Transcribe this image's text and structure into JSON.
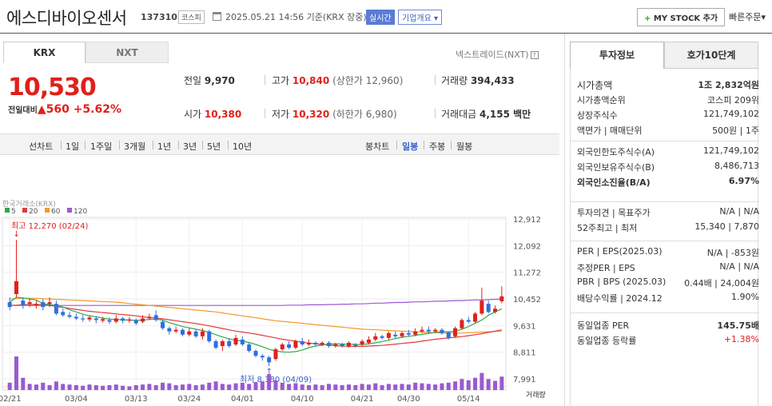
{
  "header": {
    "title": "에스디바이오센서",
    "code": "137310",
    "market": "코스피",
    "date": "2025.05.21 14:56 기준(KRX 장중)",
    "realtime": "실시간",
    "overview": "기업개요",
    "mystock": "MY STOCK 추가",
    "quick_order": "빠른주문"
  },
  "tabs": {
    "krx": "KRX",
    "nxt": "NXT",
    "nxt_link": "넥스트레이드(NXT)"
  },
  "quote": {
    "price": "10,530",
    "change_label": "전일대비",
    "change": "560",
    "change_pct": "+5.62%",
    "prev_label": "전일",
    "prev": "9,970",
    "high_label": "고가",
    "high": "10,840",
    "upper_label": "(상한가",
    "upper": "12,960)",
    "volume_label": "거래량",
    "volume": "394,433",
    "open_label": "시가",
    "open": "10,380",
    "low_label": "저가",
    "low": "10,320",
    "lower_label": "(하한가",
    "lower": "6,980)",
    "amount_label": "거래대금",
    "amount": "4,155 백만"
  },
  "periods": {
    "line_label": "선차트",
    "items": [
      "1일",
      "1주일",
      "3개월",
      "1년",
      "3년",
      "5년",
      "10년"
    ],
    "candle_label": "봉차트",
    "candles": [
      "일봉",
      "주봉",
      "월봉"
    ]
  },
  "chart_data": {
    "type": "candlestick",
    "source_label": "한국거래소(KRX)",
    "ma_legend": [
      {
        "name": "5",
        "color": "#2ea84f"
      },
      {
        "name": "20",
        "color": "#e03a3a"
      },
      {
        "name": "60",
        "color": "#f39a2b"
      },
      {
        "name": "120",
        "color": "#9b59d0"
      }
    ],
    "y_ticks": [
      "12,912",
      "12,092",
      "11,272",
      "10,452",
      "9,631",
      "8,811",
      "7,991"
    ],
    "ylim": [
      7991,
      12912
    ],
    "x_ticks": [
      "02/21",
      "03/04",
      "03/13",
      "03/24",
      "04/01",
      "04/10",
      "04/21",
      "04/30",
      "05/14"
    ],
    "max_label": "최고 12,270 (02/24)",
    "min_label": "최저 8,380 (04/09)",
    "volume_label": "거래량",
    "candles": [
      {
        "o": 10350,
        "c": 10200,
        "h": 10500,
        "l": 10100
      },
      {
        "o": 10600,
        "c": 11000,
        "h": 12270,
        "l": 10500
      },
      {
        "o": 10400,
        "c": 10250,
        "h": 10500,
        "l": 10150
      },
      {
        "o": 10300,
        "c": 10350,
        "h": 10450,
        "l": 10200
      },
      {
        "o": 10250,
        "c": 10300,
        "h": 10400,
        "l": 10150
      },
      {
        "o": 10350,
        "c": 10200,
        "h": 10450,
        "l": 10100
      },
      {
        "o": 10300,
        "c": 10350,
        "h": 10500,
        "l": 10200
      },
      {
        "o": 10300,
        "c": 10000,
        "h": 10400,
        "l": 9950
      },
      {
        "o": 10050,
        "c": 9950,
        "h": 10150,
        "l": 9900
      },
      {
        "o": 9950,
        "c": 9900,
        "h": 10050,
        "l": 9850
      },
      {
        "o": 9900,
        "c": 9850,
        "h": 10000,
        "l": 9800
      },
      {
        "o": 9850,
        "c": 9820,
        "h": 9950,
        "l": 9750
      },
      {
        "o": 9820,
        "c": 9880,
        "h": 9950,
        "l": 9750
      },
      {
        "o": 9850,
        "c": 9800,
        "h": 9900,
        "l": 9700
      },
      {
        "o": 9780,
        "c": 9830,
        "h": 9900,
        "l": 9720
      },
      {
        "o": 9800,
        "c": 9750,
        "h": 9880,
        "l": 9680
      },
      {
        "o": 9750,
        "c": 9850,
        "h": 9950,
        "l": 9700
      },
      {
        "o": 9850,
        "c": 9780,
        "h": 9900,
        "l": 9700
      },
      {
        "o": 9780,
        "c": 9820,
        "h": 9900,
        "l": 9720
      },
      {
        "o": 9800,
        "c": 9700,
        "h": 9850,
        "l": 9650
      },
      {
        "o": 9750,
        "c": 9850,
        "h": 9950,
        "l": 9700
      },
      {
        "o": 9850,
        "c": 9900,
        "h": 10000,
        "l": 9800
      },
      {
        "o": 9950,
        "c": 9800,
        "h": 10100,
        "l": 9750
      },
      {
        "o": 9750,
        "c": 9550,
        "h": 9800,
        "l": 9500
      },
      {
        "o": 9550,
        "c": 9450,
        "h": 9600,
        "l": 9350
      },
      {
        "o": 9450,
        "c": 9500,
        "h": 9600,
        "l": 9400
      },
      {
        "o": 9500,
        "c": 9350,
        "h": 9550,
        "l": 9300
      },
      {
        "o": 9350,
        "c": 9450,
        "h": 9550,
        "l": 9300
      },
      {
        "o": 9450,
        "c": 9300,
        "h": 9500,
        "l": 9250
      },
      {
        "o": 9300,
        "c": 9450,
        "h": 9550,
        "l": 9200
      },
      {
        "o": 9450,
        "c": 9150,
        "h": 9500,
        "l": 9100
      },
      {
        "o": 9150,
        "c": 8950,
        "h": 9200,
        "l": 8900
      },
      {
        "o": 9000,
        "c": 9150,
        "h": 9200,
        "l": 8850
      },
      {
        "o": 9150,
        "c": 9000,
        "h": 9250,
        "l": 8950
      },
      {
        "o": 9050,
        "c": 9250,
        "h": 9350,
        "l": 9000
      },
      {
        "o": 9200,
        "c": 9050,
        "h": 9300,
        "l": 9000
      },
      {
        "o": 9050,
        "c": 8850,
        "h": 9100,
        "l": 8800
      },
      {
        "o": 8850,
        "c": 8700,
        "h": 8900,
        "l": 8650
      },
      {
        "o": 8700,
        "c": 8650,
        "h": 8750,
        "l": 8550
      },
      {
        "o": 8650,
        "c": 8500,
        "h": 8700,
        "l": 8380
      },
      {
        "o": 8600,
        "c": 8900,
        "h": 8950,
        "l": 8550
      },
      {
        "o": 8900,
        "c": 9050,
        "h": 9100,
        "l": 8850
      },
      {
        "o": 9050,
        "c": 8950,
        "h": 9150,
        "l": 8900
      },
      {
        "o": 8950,
        "c": 9150,
        "h": 9200,
        "l": 8900
      },
      {
        "o": 9150,
        "c": 9050,
        "h": 9250,
        "l": 9000
      },
      {
        "o": 9050,
        "c": 9100,
        "h": 9200,
        "l": 9000
      },
      {
        "o": 9100,
        "c": 9050,
        "h": 9150,
        "l": 9000
      },
      {
        "o": 9050,
        "c": 9100,
        "h": 9150,
        "l": 9000
      },
      {
        "o": 9100,
        "c": 9000,
        "h": 9150,
        "l": 8950
      },
      {
        "o": 9000,
        "c": 9050,
        "h": 9100,
        "l": 8950
      },
      {
        "o": 9050,
        "c": 9000,
        "h": 9100,
        "l": 8950
      },
      {
        "o": 9000,
        "c": 9100,
        "h": 9150,
        "l": 8950
      },
      {
        "o": 9050,
        "c": 9000,
        "h": 9100,
        "l": 8950
      },
      {
        "o": 9050,
        "c": 9150,
        "h": 9200,
        "l": 9000
      },
      {
        "o": 9100,
        "c": 9200,
        "h": 9300,
        "l": 9050
      },
      {
        "o": 9200,
        "c": 9300,
        "h": 9400,
        "l": 9150
      },
      {
        "o": 9300,
        "c": 9250,
        "h": 9350,
        "l": 9200
      },
      {
        "o": 9250,
        "c": 9400,
        "h": 9450,
        "l": 9200
      },
      {
        "o": 9350,
        "c": 9300,
        "h": 9450,
        "l": 9250
      },
      {
        "o": 9300,
        "c": 9400,
        "h": 9450,
        "l": 9250
      },
      {
        "o": 9400,
        "c": 9350,
        "h": 9500,
        "l": 9300
      },
      {
        "o": 9350,
        "c": 9450,
        "h": 9550,
        "l": 9300
      },
      {
        "o": 9450,
        "c": 9500,
        "h": 9600,
        "l": 9400
      },
      {
        "o": 9500,
        "c": 9450,
        "h": 9600,
        "l": 9400
      },
      {
        "o": 9450,
        "c": 9500,
        "h": 9550,
        "l": 9400
      },
      {
        "o": 9500,
        "c": 9400,
        "h": 9550,
        "l": 9350
      },
      {
        "o": 9420,
        "c": 9250,
        "h": 9450,
        "l": 9200
      },
      {
        "o": 9300,
        "c": 9550,
        "h": 9600,
        "l": 9250
      },
      {
        "o": 9550,
        "c": 9800,
        "h": 9850,
        "l": 9500
      },
      {
        "o": 9800,
        "c": 9750,
        "h": 9900,
        "l": 9700
      },
      {
        "o": 9750,
        "c": 10000,
        "h": 10050,
        "l": 9700
      },
      {
        "o": 10000,
        "c": 10400,
        "h": 10800,
        "l": 9950
      },
      {
        "o": 10300,
        "c": 10050,
        "h": 10400,
        "l": 10000
      },
      {
        "o": 10050,
        "c": 10150,
        "h": 10250,
        "l": 10000
      },
      {
        "o": 10380,
        "c": 10530,
        "h": 10840,
        "l": 10320
      }
    ],
    "volumes": [
      12,
      55,
      20,
      10,
      9,
      12,
      8,
      14,
      10,
      9,
      8,
      7,
      9,
      8,
      7,
      8,
      9,
      7,
      6,
      8,
      9,
      10,
      8,
      12,
      11,
      8,
      9,
      10,
      8,
      9,
      12,
      14,
      10,
      9,
      11,
      12,
      10,
      13,
      14,
      26,
      16,
      12,
      10,
      11,
      9,
      8,
      9,
      8,
      10,
      9,
      8,
      9,
      8,
      10,
      9,
      11,
      8,
      10,
      9,
      10,
      9,
      12,
      11,
      10,
      9,
      11,
      12,
      14,
      18,
      16,
      20,
      28,
      18,
      15,
      22
    ],
    "ma5": [
      10350,
      10500,
      10480,
      10450,
      10420,
      10300,
      10280,
      10250,
      10200,
      10120,
      10050,
      9980,
      9930,
      9900,
      9860,
      9830,
      9820,
      9810,
      9800,
      9790,
      9800,
      9820,
      9830,
      9800,
      9720,
      9660,
      9600,
      9560,
      9520,
      9480,
      9420,
      9350,
      9280,
      9220,
      9180,
      9150,
      9110,
      9050,
      8980,
      8900,
      8850,
      8820,
      8810,
      8830,
      8880,
      8950,
      9000,
      9030,
      9060,
      9070,
      9060,
      9060,
      9050,
      9050,
      9070,
      9100,
      9140,
      9180,
      9230,
      9270,
      9300,
      9330,
      9360,
      9390,
      9420,
      9440,
      9440,
      9460,
      9520,
      9600,
      9700,
      9800,
      9950,
      10050,
      10150
    ],
    "ma20": [
      10250,
      10260,
      10270,
      10280,
      10280,
      10270,
      10250,
      10220,
      10190,
      10160,
      10130,
      10100,
      10070,
      10050,
      10030,
      10010,
      9990,
      9970,
      9950,
      9930,
      9900,
      9880,
      9860,
      9840,
      9810,
      9780,
      9750,
      9720,
      9690,
      9660,
      9620,
      9580,
      9540,
      9500,
      9460,
      9430,
      9400,
      9370,
      9330,
      9290,
      9250,
      9210,
      9180,
      9150,
      9120,
      9090,
      9070,
      9050,
      9030,
      9010,
      9000,
      8990,
      8990,
      8990,
      9000,
      9010,
      9020,
      9040,
      9060,
      9080,
      9100,
      9120,
      9150,
      9180,
      9210,
      9230,
      9250,
      9270,
      9290,
      9320,
      9350,
      9380,
      9420,
      9460,
      9500
    ],
    "ma60": [
      10450,
      10460,
      10470,
      10470,
      10470,
      10460,
      10450,
      10440,
      10430,
      10420,
      10410,
      10400,
      10390,
      10380,
      10370,
      10360,
      10350,
      10330,
      10310,
      10290,
      10270,
      10250,
      10230,
      10210,
      10190,
      10170,
      10150,
      10130,
      10110,
      10090,
      10070,
      10050,
      10020,
      9990,
      9960,
      9930,
      9900,
      9870,
      9840,
      9810,
      9780,
      9760,
      9740,
      9720,
      9700,
      9680,
      9660,
      9640,
      9620,
      9600,
      9580,
      9560,
      9540,
      9520,
      9510,
      9500,
      9490,
      9480,
      9470,
      9460,
      9450,
      9440,
      9430,
      9420,
      9410,
      9400,
      9400,
      9400,
      9400,
      9410,
      9420,
      9430,
      9440,
      9450,
      9460
    ],
    "ma120": [
      10250,
      10250,
      10250,
      10250,
      10250,
      10250,
      10250,
      10250,
      10250,
      10250,
      10250,
      10250,
      10250,
      10250,
      10250,
      10250,
      10250,
      10250,
      10250,
      10250,
      10250,
      10250,
      10250,
      10250,
      10250,
      10250,
      10250,
      10250,
      10250,
      10250,
      10250,
      10250,
      10250,
      10250,
      10250,
      10250,
      10250,
      10250,
      10250,
      10250,
      10250,
      10250,
      10260,
      10260,
      10260,
      10270,
      10270,
      10270,
      10280,
      10280,
      10290,
      10290,
      10300,
      10300,
      10310,
      10320,
      10320,
      10330,
      10340,
      10340,
      10350,
      10360,
      10360,
      10370,
      10380,
      10380,
      10390,
      10400,
      10400,
      10410,
      10420,
      10420,
      10430,
      10440,
      10450
    ]
  },
  "invest": {
    "tab_a": "투자정보",
    "tab_b": "호가10단계",
    "rows1": [
      {
        "k": "시가총액",
        "v": "1조 2,832억원"
      },
      {
        "k": "시가총액순위",
        "v": "코스피 209위"
      },
      {
        "k": "상장주식수",
        "v": "121,749,102"
      },
      {
        "k": "액면가 | 매매단위",
        "v": "500원 | 1주"
      }
    ],
    "rows2": [
      {
        "k": "외국인한도주식수(A)",
        "v": "121,749,102"
      },
      {
        "k": "외국인보유주식수(B)",
        "v": "8,486,713"
      },
      {
        "k": "외국인소진율(B/A)",
        "v": "6.97%"
      }
    ],
    "rows3": [
      {
        "k": "투자의견 | 목표주가",
        "v": "N/A | N/A"
      },
      {
        "k": "52주최고 | 최저",
        "v": "15,340 | 7,870"
      }
    ],
    "rows4": [
      {
        "k": "PER | EPS(2025.03)",
        "v": "N/A | -853원"
      },
      {
        "k": "추정PER | EPS",
        "v": "N/A | N/A"
      },
      {
        "k": "PBR | BPS (2025.03)",
        "v": "0.44배 | 24,004원"
      },
      {
        "k": "배당수익률 | 2024.12",
        "v": "1.90%"
      }
    ],
    "rows5": [
      {
        "k": "동일업종 PER",
        "v": "145.75배"
      },
      {
        "k": "동일업종 등락률",
        "v": "+1.38%"
      }
    ]
  }
}
